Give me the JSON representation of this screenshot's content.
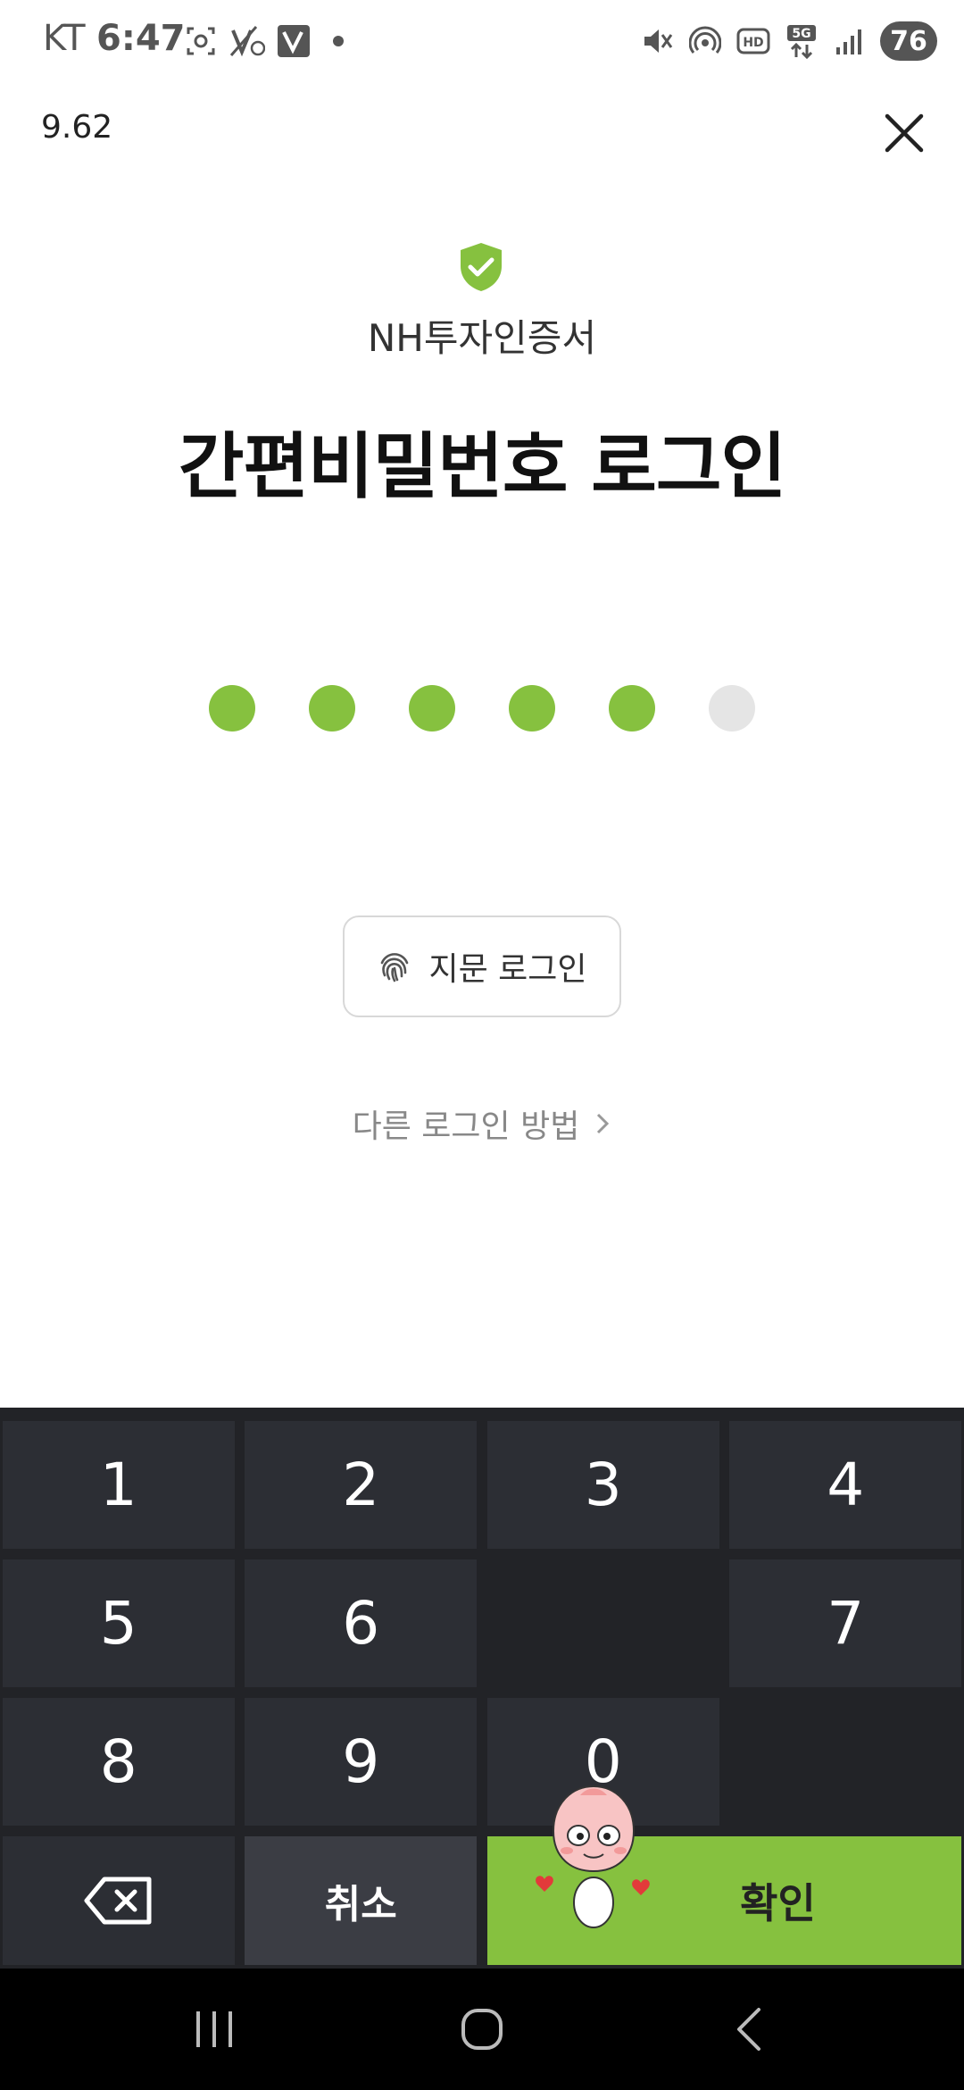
{
  "status_bar": {
    "carrier": "KT",
    "time": "6:47",
    "battery": "76",
    "icons_left": [
      "screenshot-icon",
      "data-off-icon",
      "v-app-icon"
    ],
    "icons_right": [
      "mute-icon",
      "hotspot-icon",
      "hd-icon",
      "5g-icon",
      "signal-icon",
      "battery-icon"
    ]
  },
  "version": "9.62",
  "cert_name": "NH투자인증서",
  "title": "간편비밀번호 로그인",
  "pin": {
    "length": 6,
    "entered": 5
  },
  "fingerprint_label": "지문 로그인",
  "other_login_label": "다른 로그인 방법",
  "keypad": {
    "rows": [
      [
        "1",
        "2",
        "3",
        "4"
      ],
      [
        "5",
        "6",
        "",
        "7"
      ],
      [
        "8",
        "9",
        "0",
        ""
      ]
    ],
    "cancel": "취소",
    "confirm": "확인"
  },
  "colors": {
    "accent": "#86c13f",
    "keypad_bg": "#222327",
    "key_bg": "#2c2e34"
  }
}
